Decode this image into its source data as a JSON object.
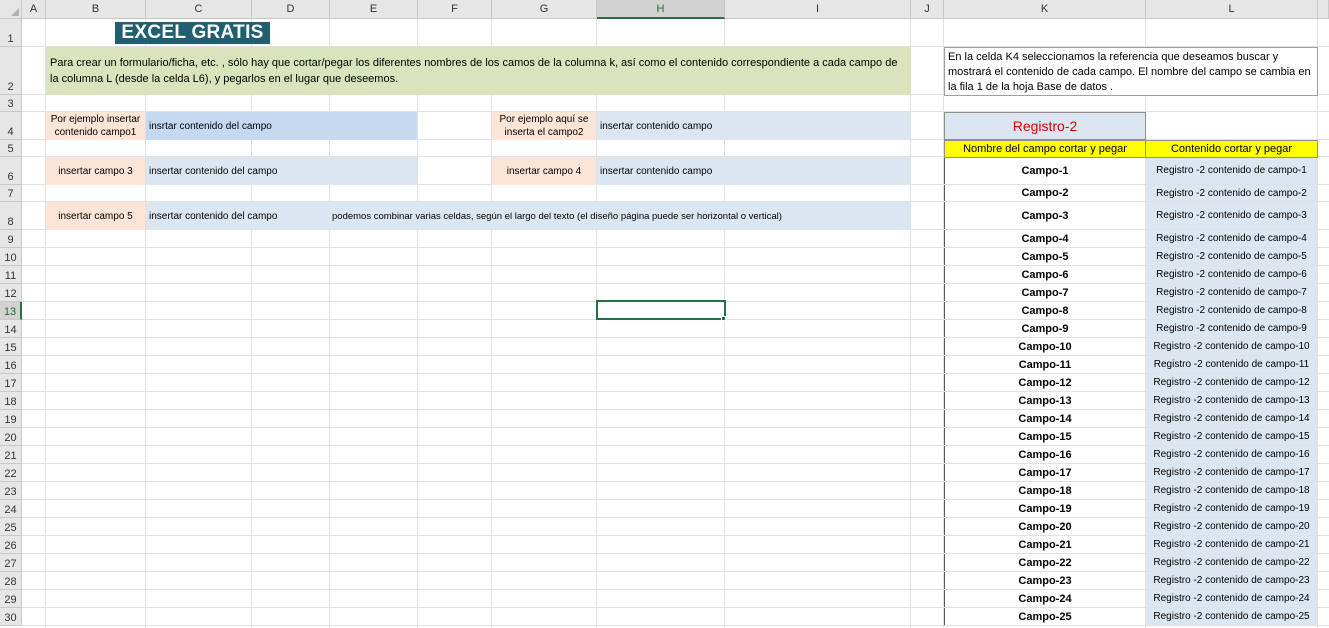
{
  "columns": [
    "A",
    "B",
    "C",
    "D",
    "E",
    "F",
    "G",
    "H",
    "I",
    "J",
    "K",
    "L"
  ],
  "selected_column": "H",
  "rows": [
    "1",
    "2",
    "3",
    "4",
    "5",
    "6",
    "7",
    "8",
    "9",
    "10",
    "11",
    "12",
    "13",
    "14",
    "15",
    "16",
    "17",
    "18",
    "19",
    "20",
    "21",
    "22",
    "23",
    "24",
    "25",
    "26",
    "27",
    "28",
    "29",
    "30"
  ],
  "selected_row": "13",
  "logo_text": "EXCEL GRATIS",
  "instructions": "Para crear un formulario/ficha, etc. , sólo hay que cortar/pegar los diferentes nombres de los camos de la columna k, así como el contenido correspondiente a cada campo de la columna L (desde la celda L6), y  pegarlos en el lugar que deseemos.",
  "side_note": "En la celda K4 seleccionamos la referencia que deseamos buscar y mostrará el contenido de cada campo. El nombre del campo se cambia en la fila 1 de la hoja Base de datos .",
  "form": {
    "b4": "Por ejemplo insertar contenido campo1",
    "c4": "insrtar contenido del campo",
    "g4": "Por ejemplo aquí se inserta el campo2",
    "h4": "insertar contenido campo",
    "b6": "insertar campo 3",
    "c6": "insertar contenido del campo",
    "g6": "insertar campo 4",
    "h6": "insertar contenido campo",
    "b8": "insertar campo 5",
    "c8": "insertar contenido del campo",
    "e8": "podemos combinar varias celdas, según el largo del texto (el diseño página puede ser horizontal o vertical)"
  },
  "registro": "Registro-2",
  "table_headers": {
    "k": "Nombre del campo cortar y pegar",
    "l": "Contenido cortar y pegar"
  },
  "campos": [
    {
      "k": "Campo-1",
      "l": "Registro -2 contenido de campo-1"
    },
    {
      "k": "Campo-2",
      "l": "Registro -2 contenido de campo-2"
    },
    {
      "k": "Campo-3",
      "l": "Registro -2 contenido de campo-3"
    },
    {
      "k": "Campo-4",
      "l": "Registro -2 contenido de campo-4"
    },
    {
      "k": "Campo-5",
      "l": "Registro -2 contenido de campo-5"
    },
    {
      "k": "Campo-6",
      "l": "Registro -2 contenido de campo-6"
    },
    {
      "k": "Campo-7",
      "l": "Registro -2 contenido de campo-7"
    },
    {
      "k": "Campo-8",
      "l": "Registro -2 contenido de campo-8"
    },
    {
      "k": "Campo-9",
      "l": "Registro -2 contenido de campo-9"
    },
    {
      "k": "Campo-10",
      "l": "Registro -2 contenido de campo-10"
    },
    {
      "k": "Campo-11",
      "l": "Registro -2 contenido de campo-11"
    },
    {
      "k": "Campo-12",
      "l": "Registro -2 contenido de campo-12"
    },
    {
      "k": "Campo-13",
      "l": "Registro -2 contenido de campo-13"
    },
    {
      "k": "Campo-14",
      "l": "Registro -2 contenido de campo-14"
    },
    {
      "k": "Campo-15",
      "l": "Registro -2 contenido de campo-15"
    },
    {
      "k": "Campo-16",
      "l": "Registro -2 contenido de campo-16"
    },
    {
      "k": "Campo-17",
      "l": "Registro -2 contenido de campo-17"
    },
    {
      "k": "Campo-18",
      "l": "Registro -2 contenido de campo-18"
    },
    {
      "k": "Campo-19",
      "l": "Registro -2 contenido de campo-19"
    },
    {
      "k": "Campo-20",
      "l": "Registro -2 contenido de campo-20"
    },
    {
      "k": "Campo-21",
      "l": "Registro -2 contenido de campo-21"
    },
    {
      "k": "Campo-22",
      "l": "Registro -2 contenido de campo-22"
    },
    {
      "k": "Campo-23",
      "l": "Registro -2 contenido de campo-23"
    },
    {
      "k": "Campo-24",
      "l": "Registro -2 contenido de campo-24"
    },
    {
      "k": "Campo-25",
      "l": "Registro -2 contenido de campo-25"
    }
  ],
  "colors": {
    "logo_bg": "#1f5f6f",
    "green_band": "#d8e4bc",
    "peach": "#fce4d6",
    "light_blue": "#dce6f1",
    "yellow_header": "#ffff00",
    "registro_red": "#e00000",
    "selection_green": "#217346"
  }
}
